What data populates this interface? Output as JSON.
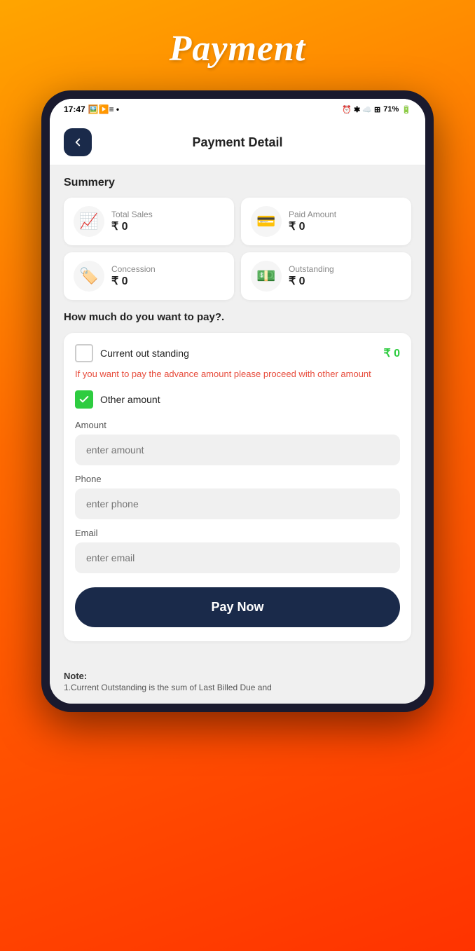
{
  "page": {
    "title": "Payment",
    "header_title": "Payment Detail",
    "back_label": "←"
  },
  "status_bar": {
    "time": "17:47",
    "battery": "71%"
  },
  "summary": {
    "section_label": "Summery",
    "cards": [
      {
        "id": "total-sales",
        "label": "Total Sales",
        "value": "₹ 0",
        "icon": "📈"
      },
      {
        "id": "paid-amount",
        "label": "Paid Amount",
        "value": "₹ 0",
        "icon": "💳"
      },
      {
        "id": "concession",
        "label": "Concession",
        "value": "₹ 0",
        "icon": "🏷️"
      },
      {
        "id": "outstanding",
        "label": "Outstanding",
        "value": "₹ 0",
        "icon": "💵"
      }
    ]
  },
  "payment": {
    "how_much_label": "How much do you want to pay?.",
    "current_outstanding_label": "Current out standing",
    "current_outstanding_value": "₹ 0",
    "advance_notice": "If you want to pay the advance amount please proceed with other amount",
    "other_amount_label": "Other amount",
    "amount_label": "Amount",
    "amount_placeholder": "enter amount",
    "phone_label": "Phone",
    "phone_placeholder": "enter phone",
    "email_label": "Email",
    "email_placeholder": "enter email",
    "pay_now_label": "Pay Now"
  },
  "note": {
    "title": "Note:",
    "text": "1.Current Outstanding is the sum of Last Billed Due and"
  }
}
